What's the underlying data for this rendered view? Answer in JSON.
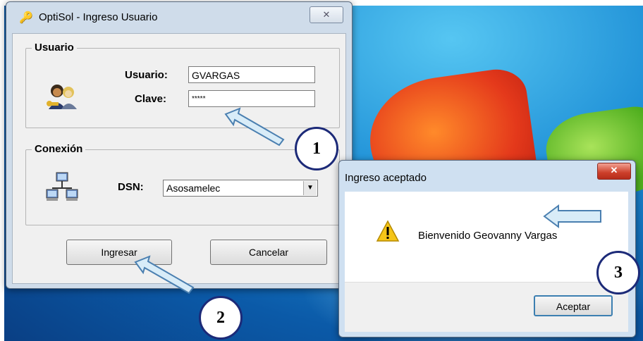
{
  "login_window": {
    "title": "OptiSol - Ingreso Usuario",
    "close_glyph": "✕",
    "groups": {
      "usuario": {
        "legend": "Usuario",
        "user_label": "Usuario:",
        "user_value": "GVARGAS",
        "password_label": "Clave:",
        "password_value": "*****"
      },
      "conexion": {
        "legend": "Conexión",
        "dsn_label": "DSN:",
        "dsn_value": "Asosamelec"
      }
    },
    "buttons": {
      "login": "Ingresar",
      "cancel": "Cancelar"
    }
  },
  "message_box": {
    "title": "Ingreso aceptado",
    "close_glyph": "✕",
    "message": "Bienvenido Geovanny Vargas",
    "ok_button": "Aceptar",
    "icon": "warning-icon"
  },
  "callouts": [
    "1",
    "2",
    "3"
  ],
  "colors": {
    "callout_border": "#1c2a78",
    "arrow_fill": "#d8ecf8",
    "arrow_stroke": "#4a7fb0",
    "close_red": "#cc3f2a"
  }
}
